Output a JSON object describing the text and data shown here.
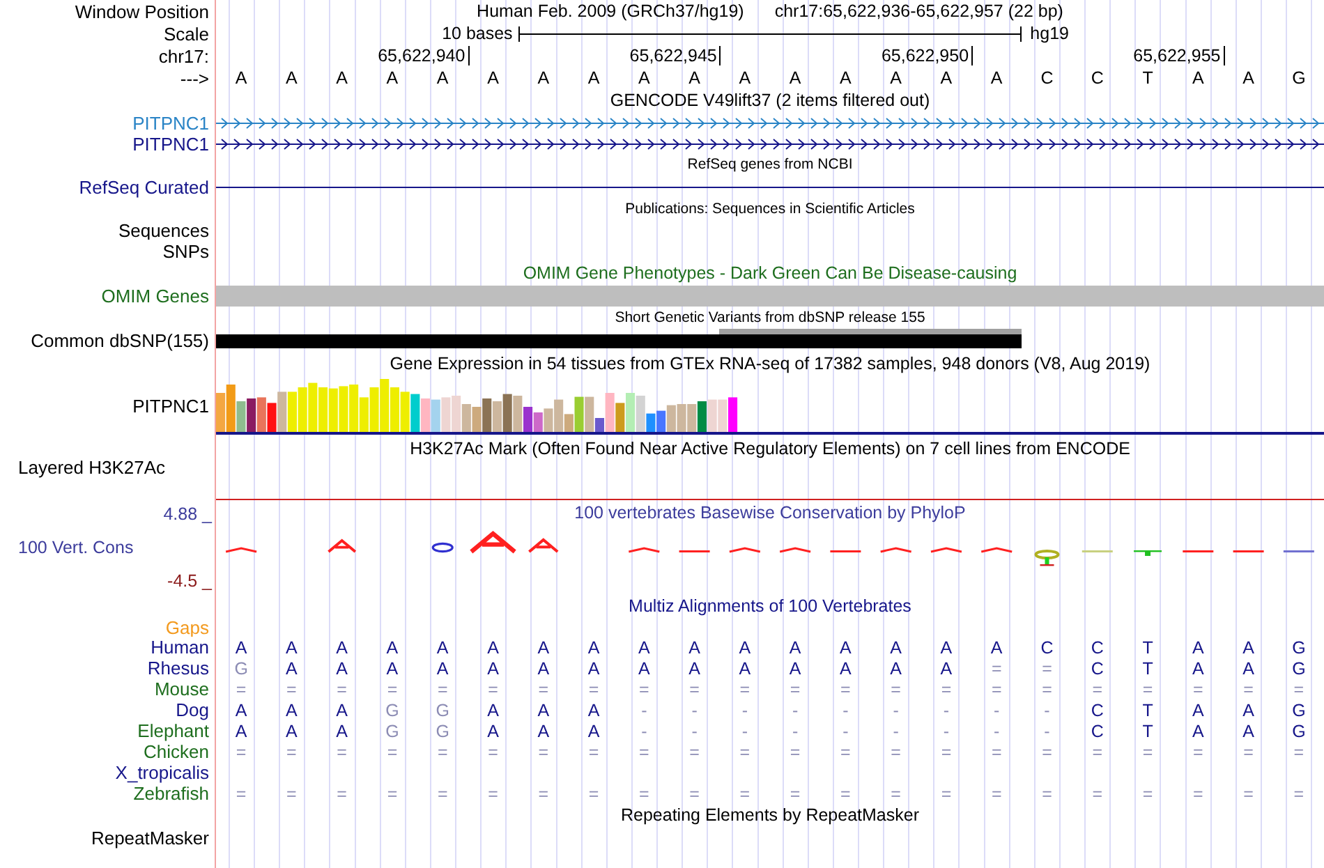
{
  "position_row": {
    "label": "Window Position",
    "assembly": "Human Feb. 2009 (GRCh37/hg19)",
    "location": "chr17:65,622,936-65,622,957 (22 bp)"
  },
  "scale_row": {
    "label": "Scale",
    "span": "10 bases",
    "assembly": "hg19"
  },
  "ruler_row": {
    "label": "chr17:",
    "ticks": [
      "65,622,940",
      "65,622,945",
      "65,622,950",
      "65,622,955"
    ]
  },
  "sequence_row": {
    "label": "--->",
    "bases": [
      "A",
      "A",
      "A",
      "A",
      "A",
      "A",
      "A",
      "A",
      "A",
      "A",
      "A",
      "A",
      "A",
      "A",
      "A",
      "A",
      "C",
      "C",
      "T",
      "A",
      "A",
      "G"
    ]
  },
  "tracks": [
    {
      "kind": "genes",
      "title": "GENCODE V49lift37 (2 items filtered out)",
      "genes": [
        {
          "label": "PITPNC1",
          "color": "#2a84c6"
        },
        {
          "label": "PITPNC1",
          "color": "#16168a"
        }
      ]
    },
    {
      "kind": "line",
      "title": "RefSeq genes from NCBI",
      "label": "RefSeq Curated",
      "color": "#16168a"
    },
    {
      "kind": "labels",
      "title": "Publications: Sequences in Scientific Articles",
      "labels": [
        "Sequences",
        "SNPs"
      ]
    },
    {
      "kind": "bar",
      "title": "OMIM Gene Phenotypes - Dark Green Can Be Disease-causing",
      "label": "OMIM Genes",
      "color": "#1e6e1e"
    },
    {
      "kind": "snp",
      "title": "Short Genetic Variants from dbSNP release 155",
      "label": "Common dbSNP(155)",
      "color": "#000000"
    },
    {
      "kind": "expression",
      "title": "Gene Expression in 54 tissues from GTEx RNA-seq of 17382 samples, 948 donors (V8, Aug 2019)",
      "label": "PITPNC1",
      "color": "#000000"
    },
    {
      "kind": "signal",
      "title": "H3K27Ac Mark (Often Found Near Active Regulatory Elements) on 7 cell lines from ENCODE",
      "label": "Layered H3K27Ac",
      "color": "#000000"
    },
    {
      "kind": "conservation",
      "title": "100 vertebrates Basewise Conservation by PhyloP",
      "label": "100 Vert. Cons",
      "color": "#3c3c9c",
      "max": "4.88 _",
      "min": "-4.5 _"
    },
    {
      "kind": "alignment",
      "title": "Multiz Alignments of 100 Vertebrates",
      "gaps_label": "Gaps",
      "species": [
        {
          "name": "Human",
          "color": "#16168a",
          "bases": [
            "A",
            "A",
            "A",
            "A",
            "A",
            "A",
            "A",
            "A",
            "A",
            "A",
            "A",
            "A",
            "A",
            "A",
            "A",
            "A",
            "C",
            "C",
            "T",
            "A",
            "A",
            "G"
          ]
        },
        {
          "name": "Rhesus",
          "color": "#16168a",
          "bases": [
            "G",
            "A",
            "A",
            "A",
            "A",
            "A",
            "A",
            "A",
            "A",
            "A",
            "A",
            "A",
            "A",
            "A",
            "A",
            "=",
            "=",
            "C",
            "T",
            "A",
            "A",
            "G"
          ]
        },
        {
          "name": "Mouse",
          "color": "#1e6e1e",
          "bases": [
            "=",
            "=",
            "=",
            "=",
            "=",
            "=",
            "=",
            "=",
            "=",
            "=",
            "=",
            "=",
            "=",
            "=",
            "=",
            "=",
            "=",
            "=",
            "=",
            "=",
            "=",
            "="
          ]
        },
        {
          "name": "Dog",
          "color": "#16168a",
          "bases": [
            "A",
            "A",
            "A",
            "G",
            "G",
            "A",
            "A",
            "A",
            "-",
            "-",
            "-",
            "-",
            "-",
            "-",
            "-",
            "-",
            "-",
            "C",
            "T",
            "A",
            "A",
            "G"
          ]
        },
        {
          "name": "Elephant",
          "color": "#1e6e1e",
          "bases": [
            "A",
            "A",
            "A",
            "G",
            "G",
            "A",
            "A",
            "A",
            "-",
            "-",
            "-",
            "-",
            "-",
            "-",
            "-",
            "-",
            "-",
            "C",
            "T",
            "A",
            "A",
            "G"
          ]
        },
        {
          "name": "Chicken",
          "color": "#1e6e1e",
          "bases": [
            "=",
            "=",
            "=",
            "=",
            "=",
            "=",
            "=",
            "=",
            "=",
            "=",
            "=",
            "=",
            "=",
            "=",
            "=",
            "=",
            "=",
            "=",
            "=",
            "=",
            "=",
            "="
          ]
        },
        {
          "name": "X_tropicalis",
          "color": "#16168a"
        },
        {
          "name": "Zebrafish",
          "color": "#1e6e1e",
          "bases": [
            "=",
            "=",
            "=",
            "=",
            "=",
            "=",
            "=",
            "=",
            "=",
            "=",
            "=",
            "=",
            "=",
            "=",
            "=",
            "=",
            "=",
            "=",
            "=",
            "=",
            "=",
            "="
          ]
        }
      ]
    },
    {
      "kind": "repeats",
      "title": "Repeating Elements by RepeatMasker",
      "label": "RepeatMasker",
      "color": "#000000"
    }
  ]
}
